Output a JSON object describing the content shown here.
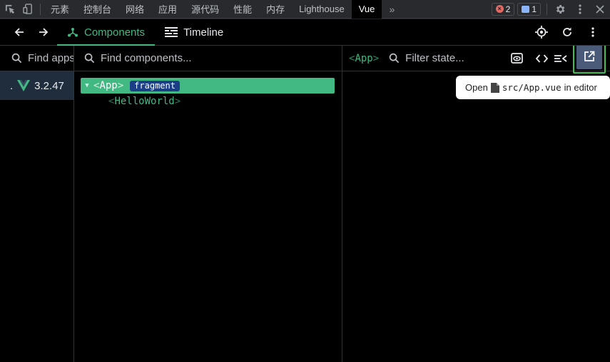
{
  "devtools": {
    "tabs": [
      "元素",
      "控制台",
      "网络",
      "应用",
      "源代码",
      "性能",
      "内存",
      "Lighthouse",
      "Vue"
    ],
    "active_tab": "Vue",
    "more_tabs": "»",
    "error_count": "2",
    "message_count": "1"
  },
  "vue_nav": {
    "components_label": "Components",
    "timeline_label": "Timeline"
  },
  "apps_pane": {
    "search_placeholder": "Find apps...",
    "version": "3.2.47",
    "prefix": "."
  },
  "tree_pane": {
    "search_placeholder": "Find components...",
    "root": {
      "name": "App",
      "badge": "fragment"
    },
    "child": {
      "name": "HelloWorld"
    }
  },
  "state_pane": {
    "breadcrumb": "App",
    "filter_placeholder": "Filter state..."
  },
  "tooltip": {
    "open": "Open",
    "path": "src/App.vue",
    "suffix": "in editor"
  },
  "colors": {
    "vue_green": "#42b883",
    "highlight_border": "#3ec14d",
    "fragment_badge": "#1b3e87"
  }
}
